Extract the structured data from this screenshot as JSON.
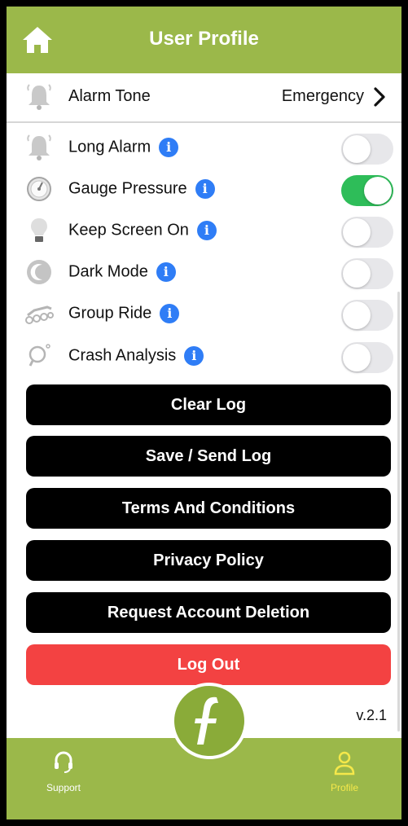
{
  "header": {
    "title": "User Profile",
    "home_icon": "home-icon"
  },
  "alarm_tone": {
    "label": "Alarm Tone",
    "value": "Emergency",
    "icon": "bell-icon"
  },
  "settings": [
    {
      "label": "Long Alarm",
      "icon": "bell-icon",
      "on": false
    },
    {
      "label": "Gauge Pressure",
      "icon": "gauge-icon",
      "on": true
    },
    {
      "label": "Keep Screen On",
      "icon": "lightbulb-icon",
      "on": false
    },
    {
      "label": "Dark Mode",
      "icon": "moon-icon",
      "on": false
    },
    {
      "label": "Group Ride",
      "icon": "bikes-icon",
      "on": false
    },
    {
      "label": "Crash Analysis",
      "icon": "magnifier-icon",
      "on": false
    }
  ],
  "buttons": {
    "clear_log": "Clear Log",
    "save_send_log": "Save / Send Log",
    "terms": "Terms And Conditions",
    "privacy": "Privacy Policy",
    "delete_account": "Request Account Deletion",
    "logout": "Log Out"
  },
  "version": "v.2.1",
  "tabbar": {
    "support": "Support",
    "profile": "Profile"
  },
  "colors": {
    "brand_green": "#9bb84a",
    "toggle_on": "#2ebd59",
    "logout_red": "#f34242",
    "info_blue": "#2f7df6",
    "active_tab": "#f5e84a"
  }
}
